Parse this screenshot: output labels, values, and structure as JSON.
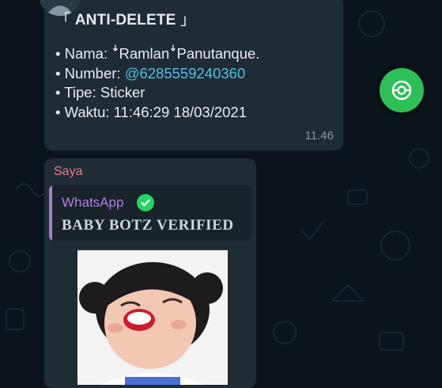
{
  "deleted_message": {
    "title": "ANTI-DELETE",
    "bracket_open": "「",
    "bracket_close": "」",
    "nama": "• Nama: ꜜRamlanꜜPanutanque.",
    "number_label": "• Number: ",
    "number_value": "@6285559240360",
    "tipe": "• Tipe: Sticker",
    "waktu": "• Waktu: 11:46:29 18/03/2021",
    "time": "11.46"
  },
  "reply_message": {
    "sender": "Saya",
    "quoted_name": "WhatsApp",
    "quoted_text": "BABY BOTZ VERIFIED"
  },
  "colors": {
    "background": "#0b141a",
    "bubble": "#1f2c34",
    "link": "#53bdeb",
    "sender": "#f27a8b",
    "quote_accent": "#a77ec8",
    "fab": "#2fbf58"
  },
  "icons": {
    "avatar": "avatar-icon",
    "verified": "verified-check-icon",
    "fab": "scroll-down-icon"
  }
}
